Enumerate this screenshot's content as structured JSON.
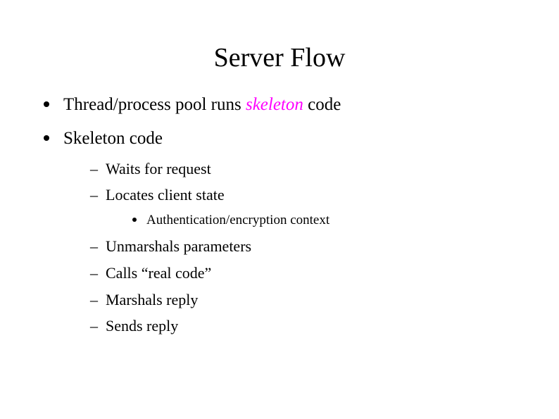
{
  "title": "Server Flow",
  "bullets": {
    "b1": {
      "prefix": "Thread/process pool runs ",
      "highlight": "skeleton",
      "suffix": " code"
    },
    "b2": {
      "text": "Skeleton code",
      "sub": {
        "s1": "Waits for request",
        "s2": {
          "text": "Locates client state",
          "sub": {
            "t1": "Authentication/encryption context"
          }
        },
        "s3": "Unmarshals parameters",
        "s4": "Calls “real code”",
        "s5": "Marshals reply",
        "s6": "Sends reply"
      }
    }
  }
}
